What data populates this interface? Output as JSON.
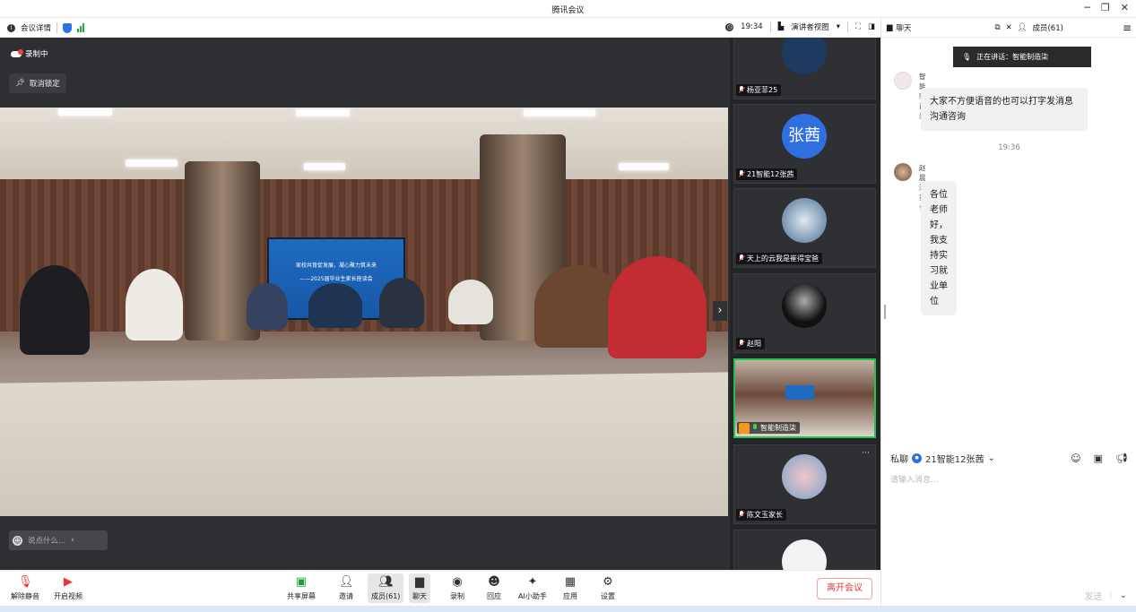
{
  "window": {
    "title": "腾讯会议"
  },
  "toolbar": {
    "meeting_details": "会议详情",
    "time": "19:34",
    "view_mode": "演讲者视图",
    "chat_label": "聊天",
    "members_label": "成员(61)"
  },
  "main": {
    "recording": "录制中",
    "unlock": "取消锁定",
    "chat_placeholder": "说点什么...",
    "banner_line1": "家校共育促发展，凝心聚力筑未来",
    "banner_line2": "——2025届毕业生家长座谈会"
  },
  "gallery": [
    {
      "name": "杨亚菲25",
      "muted": true
    },
    {
      "name": "21智能12张茜",
      "avatar_text": "张茜",
      "avatar_color": "#2f6fe0",
      "muted": true
    },
    {
      "name": "天上的云我是崔得宝爸",
      "muted": true
    },
    {
      "name": "赵阳",
      "muted": true
    },
    {
      "name": "智能制造柒",
      "muted": false,
      "active": true
    },
    {
      "name": "陈文玉家长",
      "muted": true
    },
    {
      "name": "",
      "muted": true
    }
  ],
  "chat": {
    "speaking": "正在讲话：智能制造柒",
    "messages": [
      {
        "sender": "智能制造柒",
        "text": "大家不方便语音的也可以打字发消息沟通咨询"
      },
      {
        "sender": "赵晨淑家长",
        "text": "各位老师好，我支持实习就业单位"
      }
    ],
    "timestamp": "19:36",
    "private_label": "私聊",
    "private_target": "21智能12张茜",
    "input_placeholder": "请输入消息...",
    "send": "发送"
  },
  "bottom": {
    "unmute": "解除静音",
    "start_video": "开启视频",
    "share": "共享屏幕",
    "invite": "邀请",
    "members": "成员(61)",
    "chat": "聊天",
    "record": "录制",
    "react": "回应",
    "ai": "AI小助手",
    "apps": "应用",
    "settings": "设置",
    "leave": "离开会议"
  },
  "colors": {
    "accent_green": "#25c24a",
    "leave_red": "#e23a3a",
    "brand_blue": "#2f6fe8"
  }
}
